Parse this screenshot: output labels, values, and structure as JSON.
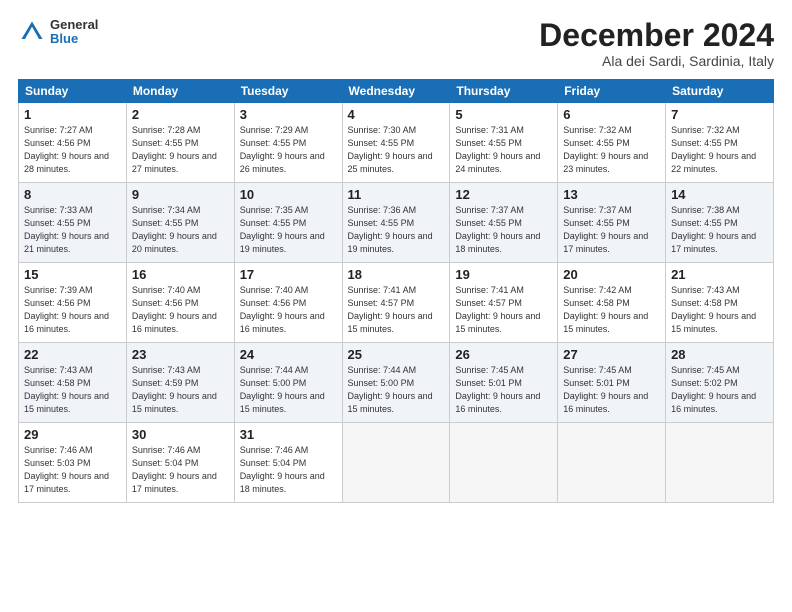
{
  "header": {
    "logo_general": "General",
    "logo_blue": "Blue",
    "month": "December 2024",
    "location": "Ala dei Sardi, Sardinia, Italy"
  },
  "days_of_week": [
    "Sunday",
    "Monday",
    "Tuesday",
    "Wednesday",
    "Thursday",
    "Friday",
    "Saturday"
  ],
  "weeks": [
    [
      {
        "day": 1,
        "sunrise": "7:27 AM",
        "sunset": "4:56 PM",
        "daylight": "9 hours and 28 minutes."
      },
      {
        "day": 2,
        "sunrise": "7:28 AM",
        "sunset": "4:55 PM",
        "daylight": "9 hours and 27 minutes."
      },
      {
        "day": 3,
        "sunrise": "7:29 AM",
        "sunset": "4:55 PM",
        "daylight": "9 hours and 26 minutes."
      },
      {
        "day": 4,
        "sunrise": "7:30 AM",
        "sunset": "4:55 PM",
        "daylight": "9 hours and 25 minutes."
      },
      {
        "day": 5,
        "sunrise": "7:31 AM",
        "sunset": "4:55 PM",
        "daylight": "9 hours and 24 minutes."
      },
      {
        "day": 6,
        "sunrise": "7:32 AM",
        "sunset": "4:55 PM",
        "daylight": "9 hours and 23 minutes."
      },
      {
        "day": 7,
        "sunrise": "7:32 AM",
        "sunset": "4:55 PM",
        "daylight": "9 hours and 22 minutes."
      }
    ],
    [
      {
        "day": 8,
        "sunrise": "7:33 AM",
        "sunset": "4:55 PM",
        "daylight": "9 hours and 21 minutes."
      },
      {
        "day": 9,
        "sunrise": "7:34 AM",
        "sunset": "4:55 PM",
        "daylight": "9 hours and 20 minutes."
      },
      {
        "day": 10,
        "sunrise": "7:35 AM",
        "sunset": "4:55 PM",
        "daylight": "9 hours and 19 minutes."
      },
      {
        "day": 11,
        "sunrise": "7:36 AM",
        "sunset": "4:55 PM",
        "daylight": "9 hours and 19 minutes."
      },
      {
        "day": 12,
        "sunrise": "7:37 AM",
        "sunset": "4:55 PM",
        "daylight": "9 hours and 18 minutes."
      },
      {
        "day": 13,
        "sunrise": "7:37 AM",
        "sunset": "4:55 PM",
        "daylight": "9 hours and 17 minutes."
      },
      {
        "day": 14,
        "sunrise": "7:38 AM",
        "sunset": "4:55 PM",
        "daylight": "9 hours and 17 minutes."
      }
    ],
    [
      {
        "day": 15,
        "sunrise": "7:39 AM",
        "sunset": "4:56 PM",
        "daylight": "9 hours and 16 minutes."
      },
      {
        "day": 16,
        "sunrise": "7:40 AM",
        "sunset": "4:56 PM",
        "daylight": "9 hours and 16 minutes."
      },
      {
        "day": 17,
        "sunrise": "7:40 AM",
        "sunset": "4:56 PM",
        "daylight": "9 hours and 16 minutes."
      },
      {
        "day": 18,
        "sunrise": "7:41 AM",
        "sunset": "4:57 PM",
        "daylight": "9 hours and 15 minutes."
      },
      {
        "day": 19,
        "sunrise": "7:41 AM",
        "sunset": "4:57 PM",
        "daylight": "9 hours and 15 minutes."
      },
      {
        "day": 20,
        "sunrise": "7:42 AM",
        "sunset": "4:58 PM",
        "daylight": "9 hours and 15 minutes."
      },
      {
        "day": 21,
        "sunrise": "7:43 AM",
        "sunset": "4:58 PM",
        "daylight": "9 hours and 15 minutes."
      }
    ],
    [
      {
        "day": 22,
        "sunrise": "7:43 AM",
        "sunset": "4:58 PM",
        "daylight": "9 hours and 15 minutes."
      },
      {
        "day": 23,
        "sunrise": "7:43 AM",
        "sunset": "4:59 PM",
        "daylight": "9 hours and 15 minutes."
      },
      {
        "day": 24,
        "sunrise": "7:44 AM",
        "sunset": "5:00 PM",
        "daylight": "9 hours and 15 minutes."
      },
      {
        "day": 25,
        "sunrise": "7:44 AM",
        "sunset": "5:00 PM",
        "daylight": "9 hours and 15 minutes."
      },
      {
        "day": 26,
        "sunrise": "7:45 AM",
        "sunset": "5:01 PM",
        "daylight": "9 hours and 16 minutes."
      },
      {
        "day": 27,
        "sunrise": "7:45 AM",
        "sunset": "5:01 PM",
        "daylight": "9 hours and 16 minutes."
      },
      {
        "day": 28,
        "sunrise": "7:45 AM",
        "sunset": "5:02 PM",
        "daylight": "9 hours and 16 minutes."
      }
    ],
    [
      {
        "day": 29,
        "sunrise": "7:46 AM",
        "sunset": "5:03 PM",
        "daylight": "9 hours and 17 minutes."
      },
      {
        "day": 30,
        "sunrise": "7:46 AM",
        "sunset": "5:04 PM",
        "daylight": "9 hours and 17 minutes."
      },
      {
        "day": 31,
        "sunrise": "7:46 AM",
        "sunset": "5:04 PM",
        "daylight": "9 hours and 18 minutes."
      },
      null,
      null,
      null,
      null
    ]
  ]
}
